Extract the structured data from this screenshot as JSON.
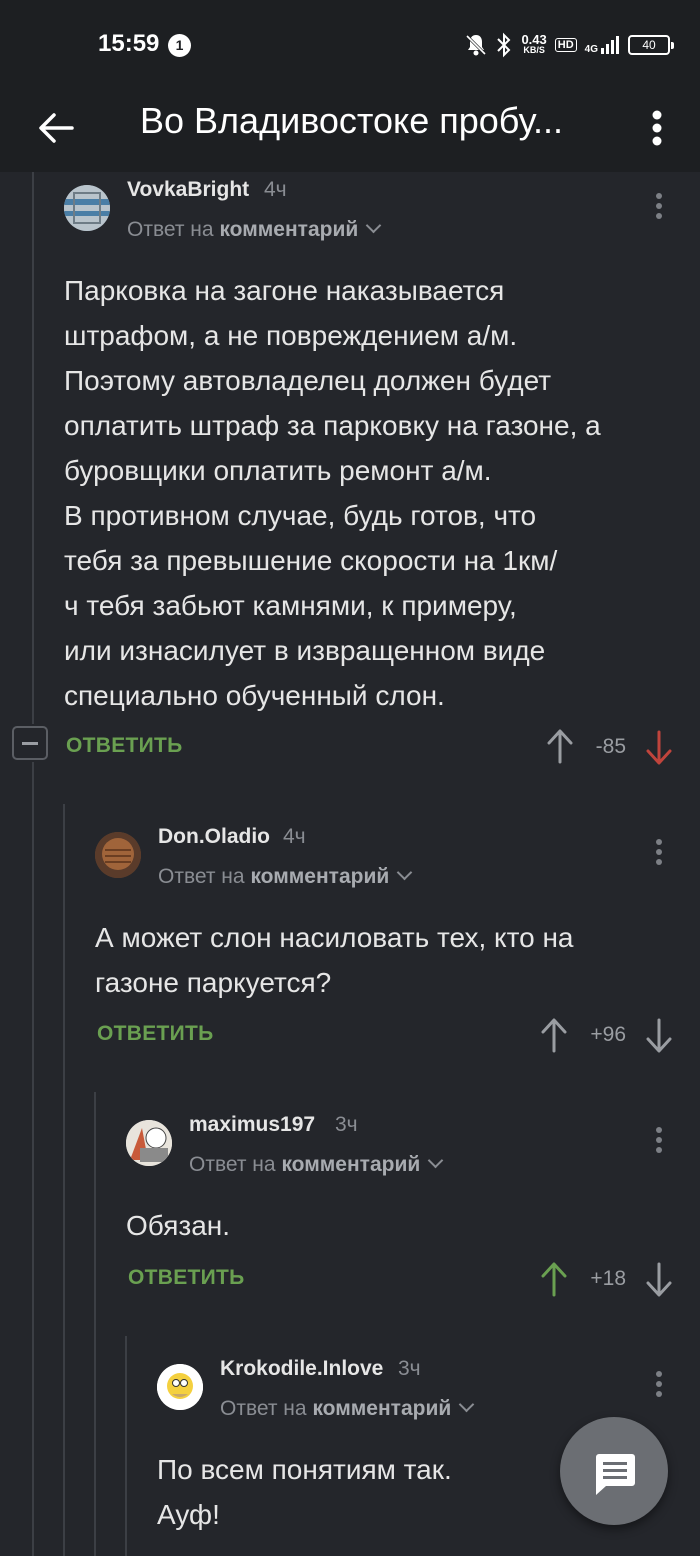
{
  "status_bar": {
    "time": "15:59",
    "notification_count": "1",
    "net_speed": "0.43",
    "net_unit": "KB/S",
    "hd": "HD",
    "network": "4G",
    "battery": "40"
  },
  "header": {
    "title": "Во Владивостоке пробу..."
  },
  "ui": {
    "reply_prefix": "Ответ на",
    "reply_target": "комментарий",
    "reply_button": "ОТВЕТИТЬ"
  },
  "comments": [
    {
      "username": "VovkaBright",
      "time": "4ч",
      "lines": [
        "Парковка на загоне наказывается",
        "штрафом, а не повреждением а/м.",
        "Поэтому автовладелец должен будет",
        "оплатить штраф за парковку на газоне, а",
        "буровщики оплатить ремонт а/м.",
        "В противном случае, будь готов, что",
        "тебя за превышение скорости на 1км/",
        "ч тебя забьют камнями, к примеру,",
        "или изнасилует в извращенном виде",
        "специально обученный слон."
      ],
      "score": "-85",
      "vote": "down"
    },
    {
      "username": "Don.Oladio",
      "time": "4ч",
      "lines": [
        "А может слон насиловать тех, кто на",
        "газоне паркуется?"
      ],
      "score": "+96",
      "vote": "none"
    },
    {
      "username": "maximus197",
      "time": "3ч",
      "lines": [
        "Обязан."
      ],
      "score": "+18",
      "vote": "up"
    },
    {
      "username": "Krokodile.Inlove",
      "time": "3ч",
      "lines": [
        "По всем понятиям так.",
        "Ауф!"
      ]
    }
  ],
  "colors": {
    "background": "#24262b",
    "accent_green": "#6aa051",
    "vote_red": "#c0443c",
    "muted": "#8a8d93"
  }
}
